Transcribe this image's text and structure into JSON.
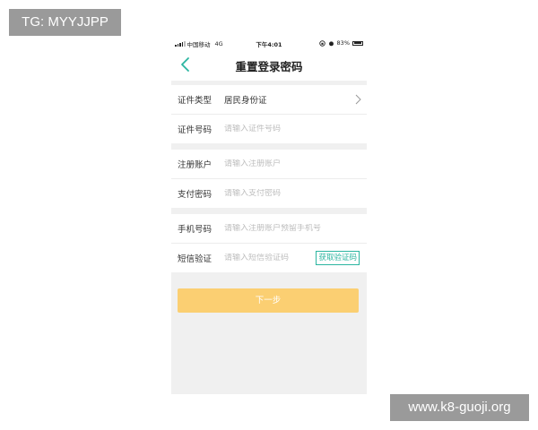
{
  "watermarks": {
    "top_left": "TG: MYYJJPP",
    "bottom_right": "www.k8-guoji.org"
  },
  "status_bar": {
    "carrier": "中国移动",
    "network": "4G",
    "time": "下午4:01",
    "battery": "83%"
  },
  "nav": {
    "title": "重置登录密码",
    "back_icon": "chevron-left-icon"
  },
  "form": {
    "id_type": {
      "label": "证件类型",
      "value": "居民身份证"
    },
    "id_number": {
      "label": "证件号码",
      "placeholder": "请输入证件号码"
    },
    "account": {
      "label": "注册账户",
      "placeholder": "请输入注册账户"
    },
    "pay_password": {
      "label": "支付密码",
      "placeholder": "请输入支付密码"
    },
    "phone": {
      "label": "手机号码",
      "placeholder": "请输入注册账户预留手机号"
    },
    "sms_code": {
      "label": "短信验证",
      "placeholder": "请输入短信验证码",
      "button": "获取验证码"
    }
  },
  "next_button": "下一步",
  "colors": {
    "accent": "#2bb5a0",
    "next_button_bg": "#fbcf72",
    "page_bg": "#f0f0f0"
  }
}
